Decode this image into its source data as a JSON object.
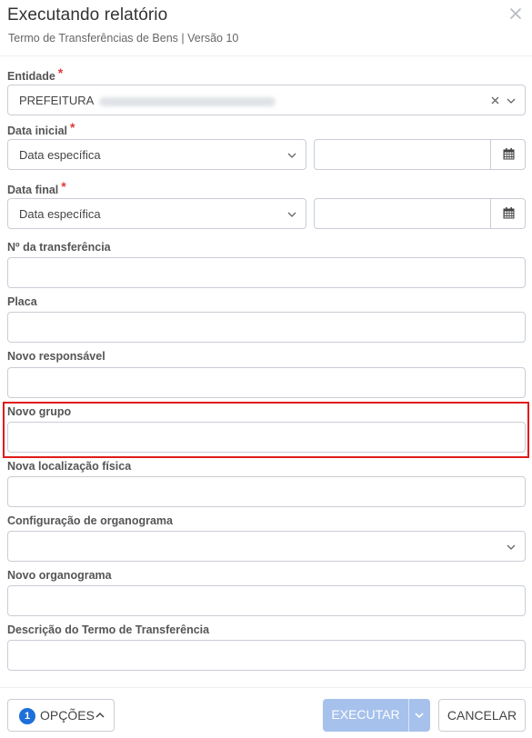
{
  "header": {
    "title": "Executando relatório",
    "subtitle": "Termo de Transferências de Bens | Versão 10"
  },
  "fields": {
    "entidade": {
      "label": "Entidade",
      "required_mark": "*",
      "value": "PREFEITURA"
    },
    "data_inicial": {
      "label": "Data inicial",
      "required_mark": "*",
      "select_value": "Data específica",
      "date_value": ""
    },
    "data_final": {
      "label": "Data final",
      "required_mark": "*",
      "select_value": "Data específica",
      "date_value": ""
    },
    "numero_transferencia": {
      "label": "Nº da transferência",
      "value": ""
    },
    "placa": {
      "label": "Placa",
      "value": ""
    },
    "novo_responsavel": {
      "label": "Novo responsável",
      "value": ""
    },
    "novo_grupo": {
      "label": "Novo grupo",
      "value": ""
    },
    "nova_localizacao": {
      "label": "Nova localização física",
      "value": ""
    },
    "config_organograma": {
      "label": "Configuração de organograma",
      "value": ""
    },
    "novo_organograma": {
      "label": "Novo organograma",
      "value": ""
    },
    "descricao_termo": {
      "label": "Descrição do Termo de Transferência",
      "value": ""
    }
  },
  "footer": {
    "options_count": "1",
    "options_label": "OPÇÕES",
    "execute_label": "EXECUTAR",
    "cancel_label": "CANCELAR"
  },
  "icons": {
    "close": "close-icon",
    "clear": "clear-icon",
    "dropdown": "chevron-down-icon",
    "calendar": "calendar-icon",
    "options_toggle": "chevron-up-icon"
  },
  "colors": {
    "required": "#e53935",
    "highlight": "#e01b1b",
    "badge": "#1e6fd9",
    "execute_disabled": "#a6c1ec"
  }
}
